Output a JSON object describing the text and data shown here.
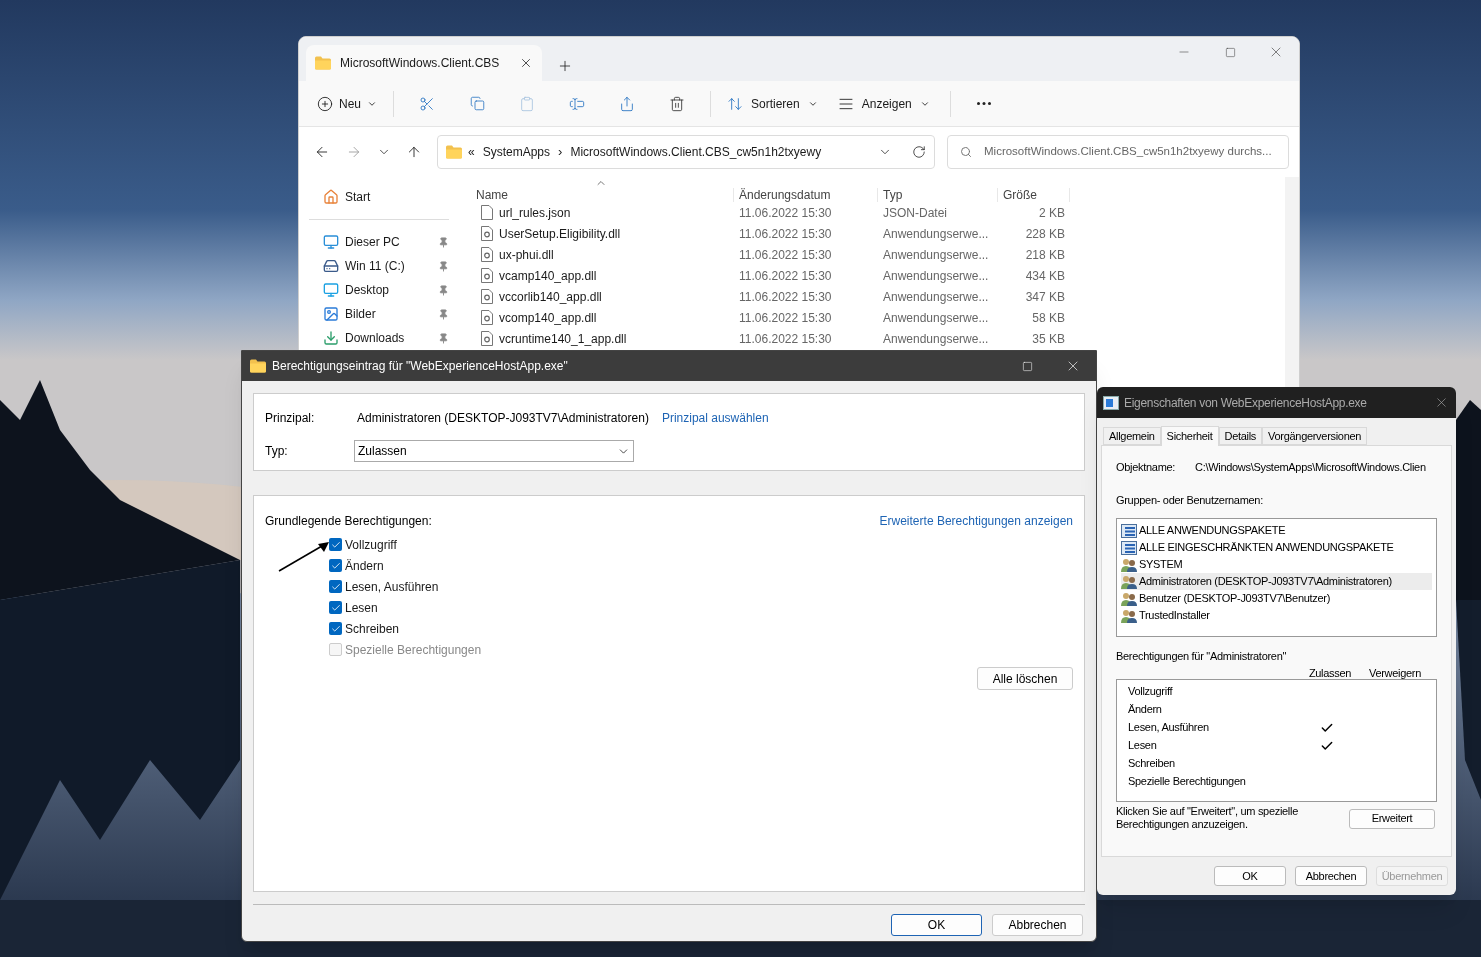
{
  "explorer": {
    "tab_title": "MicrosoftWindows.Client.CBS",
    "toolbar": {
      "new_label": "Neu",
      "sort_label": "Sortieren",
      "view_label": "Anzeigen"
    },
    "address": {
      "overflow": "«",
      "separator": "›",
      "breadcrumbs": [
        "SystemApps",
        "MicrosoftWindows.Client.CBS_cw5n1h2txyewy"
      ]
    },
    "search": {
      "placeholder": "MicrosoftWindows.Client.CBS_cw5n1h2txyewy durchs..."
    },
    "sidebar": [
      {
        "label": "Start",
        "kind": "home",
        "pinned": false
      },
      {
        "label": "Dieser PC",
        "kind": "pc",
        "pinned": true
      },
      {
        "label": "Win 11 (C:)",
        "kind": "drive",
        "pinned": true
      },
      {
        "label": "Desktop",
        "kind": "desktop",
        "pinned": true
      },
      {
        "label": "Bilder",
        "kind": "pictures",
        "pinned": true
      },
      {
        "label": "Downloads",
        "kind": "downloads",
        "pinned": true
      }
    ],
    "columns": [
      "Name",
      "Änderungsdatum",
      "Typ",
      "Größe"
    ],
    "rows": [
      {
        "name": "url_rules.json",
        "date": "11.06.2022 15:30",
        "type": "JSON-Datei",
        "size": "2 KB",
        "kind": "file"
      },
      {
        "name": "UserSetup.Eligibility.dll",
        "date": "11.06.2022 15:30",
        "type": "Anwendungserwe...",
        "size": "228 KB",
        "kind": "dll"
      },
      {
        "name": "ux-phui.dll",
        "date": "11.06.2022 15:30",
        "type": "Anwendungserwe...",
        "size": "218 KB",
        "kind": "dll"
      },
      {
        "name": "vcamp140_app.dll",
        "date": "11.06.2022 15:30",
        "type": "Anwendungserwe...",
        "size": "434 KB",
        "kind": "dll"
      },
      {
        "name": "vccorlib140_app.dll",
        "date": "11.06.2022 15:30",
        "type": "Anwendungserwe...",
        "size": "347 KB",
        "kind": "dll"
      },
      {
        "name": "vcomp140_app.dll",
        "date": "11.06.2022 15:30",
        "type": "Anwendungserwe...",
        "size": "58 KB",
        "kind": "dll"
      },
      {
        "name": "vcruntime140_1_app.dll",
        "date": "11.06.2022 15:30",
        "type": "Anwendungserwe...",
        "size": "35 KB",
        "kind": "dll"
      }
    ]
  },
  "entry_dialog": {
    "title": "Berechtigungseintrag für \"WebExperienceHostApp.exe\"",
    "principal_label": "Prinzipal:",
    "principal_value": "Administratoren (DESKTOP-J093TV7\\Administratoren)",
    "principal_link": "Prinzipal auswählen",
    "type_label": "Typ:",
    "type_value": "Zulassen",
    "permissions_heading": "Grundlegende Berechtigungen:",
    "advanced_link": "Erweiterte Berechtigungen anzeigen",
    "permissions": [
      {
        "label": "Vollzugriff",
        "checked": true,
        "disabled": false
      },
      {
        "label": "Ändern",
        "checked": true,
        "disabled": false
      },
      {
        "label": "Lesen, Ausführen",
        "checked": true,
        "disabled": false
      },
      {
        "label": "Lesen",
        "checked": true,
        "disabled": false
      },
      {
        "label": "Schreiben",
        "checked": true,
        "disabled": false
      },
      {
        "label": "Spezielle Berechtigungen",
        "checked": false,
        "disabled": true
      }
    ],
    "clear_button": "Alle löschen",
    "buttons": [
      {
        "label": "OK",
        "default": true
      },
      {
        "label": "Abbrechen",
        "default": false
      }
    ]
  },
  "properties_dialog": {
    "title": "Eigenschaften von WebExperienceHostApp.exe",
    "tabs": [
      {
        "label": "Allgemein",
        "selected": false
      },
      {
        "label": "Sicherheit",
        "selected": true
      },
      {
        "label": "Details",
        "selected": false
      },
      {
        "label": "Vorgängerversionen",
        "selected": false
      }
    ],
    "object_label": "Objektname:",
    "object_value": "C:\\Windows\\SystemApps\\MicrosoftWindows.Clien",
    "groups_label": "Gruppen- oder Benutzernamen:",
    "groups": [
      {
        "name": "ALLE ANWENDUNGSPAKETE",
        "kind": "package",
        "selected": false
      },
      {
        "name": "ALLE EINGESCHRÄNKTEN ANWENDUNGSPAKETE",
        "kind": "package",
        "selected": false
      },
      {
        "name": "SYSTEM",
        "kind": "users",
        "selected": false
      },
      {
        "name": "Administratoren (DESKTOP-J093TV7\\Administratoren)",
        "kind": "users",
        "selected": true
      },
      {
        "name": "Benutzer (DESKTOP-J093TV7\\Benutzer)",
        "kind": "users",
        "selected": false
      },
      {
        "name": "TrustedInstaller",
        "kind": "users",
        "selected": false
      }
    ],
    "permissions_heading": "Berechtigungen für \"Administratoren\"",
    "allow_header": "Zulassen",
    "deny_header": "Verweigern",
    "permissions": [
      {
        "label": "Vollzugriff",
        "allow": false,
        "deny": false
      },
      {
        "label": "Ändern",
        "allow": false,
        "deny": false
      },
      {
        "label": "Lesen, Ausführen",
        "allow": true,
        "deny": false
      },
      {
        "label": "Lesen",
        "allow": true,
        "deny": false
      },
      {
        "label": "Schreiben",
        "allow": false,
        "deny": false
      },
      {
        "label": "Spezielle Berechtigungen",
        "allow": false,
        "deny": false
      }
    ],
    "hint": "Klicken Sie auf \"Erweitert\", um spezielle Berechtigungen anzuzeigen.",
    "advanced_button": "Erweitert",
    "buttons": [
      {
        "label": "OK",
        "disabled": false
      },
      {
        "label": "Abbrechen",
        "disabled": false
      },
      {
        "label": "Übernehmen",
        "disabled": true
      }
    ]
  }
}
